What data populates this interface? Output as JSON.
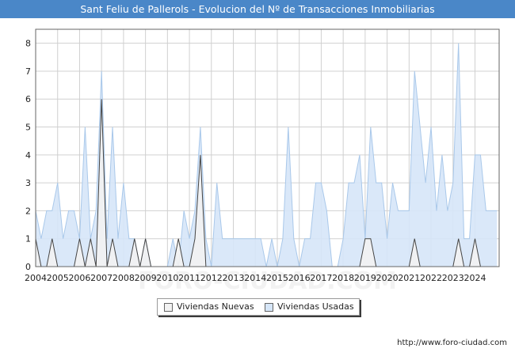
{
  "title": "Sant Feliu de Pallerols - Evolucion del Nº de Transacciones Inmobiliarias",
  "watermark": "FORO-CIUDAD.COM",
  "url": "http://www.foro-ciudad.com",
  "colors": {
    "title_bg": "#4a87c8",
    "usadas_fill": "#d6e6f8",
    "usadas_line": "#a9c8ea",
    "nuevas_fill": "#f2f2f2",
    "nuevas_line": "#444444",
    "grid": "#d0d0d0"
  },
  "chart_data": {
    "type": "area",
    "title": "Sant Feliu de Pallerols - Evolucion del Nº de Transacciones Inmobiliarias",
    "xlabel": "",
    "ylabel": "",
    "x_ticks": [
      "2004",
      "2005",
      "2006",
      "2007",
      "2008",
      "2009",
      "2010",
      "2011",
      "2012",
      "2013",
      "2014",
      "2015",
      "2016",
      "2017",
      "2018",
      "2019",
      "2020",
      "2021",
      "2022",
      "2023",
      "2024"
    ],
    "y_ticks": [
      0,
      1,
      2,
      3,
      4,
      5,
      6,
      7,
      8
    ],
    "ylim": [
      0,
      8.5
    ],
    "xlim": [
      2004,
      2025.1
    ],
    "grid": true,
    "legend_position": "bottom-center",
    "series": [
      {
        "name": "Viviendas Usadas",
        "x": [
          2004.0,
          2004.25,
          2004.5,
          2004.75,
          2005.0,
          2005.25,
          2005.5,
          2005.75,
          2006.0,
          2006.25,
          2006.5,
          2006.75,
          2007.0,
          2007.25,
          2007.5,
          2007.75,
          2008.0,
          2008.25,
          2008.5,
          2008.75,
          2009.0,
          2009.25,
          2009.5,
          2009.75,
          2010.0,
          2010.25,
          2010.5,
          2010.75,
          2011.0,
          2011.25,
          2011.5,
          2011.75,
          2012.0,
          2012.25,
          2012.5,
          2012.75,
          2013.0,
          2013.25,
          2013.5,
          2013.75,
          2014.0,
          2014.25,
          2014.5,
          2014.75,
          2015.0,
          2015.25,
          2015.5,
          2015.75,
          2016.0,
          2016.25,
          2016.5,
          2016.75,
          2017.0,
          2017.25,
          2017.5,
          2017.75,
          2018.0,
          2018.25,
          2018.5,
          2018.75,
          2019.0,
          2019.25,
          2019.5,
          2019.75,
          2020.0,
          2020.25,
          2020.5,
          2020.75,
          2021.0,
          2021.25,
          2021.5,
          2021.75,
          2022.0,
          2022.25,
          2022.5,
          2022.75,
          2023.0,
          2023.25,
          2023.5,
          2023.75,
          2024.0,
          2024.25,
          2024.5,
          2024.75,
          2025.0
        ],
        "values": [
          2,
          1,
          2,
          2,
          3,
          1,
          2,
          2,
          1,
          5,
          1,
          2,
          7,
          1,
          5,
          1,
          3,
          1,
          1,
          0,
          1,
          0,
          0,
          0,
          0,
          1,
          0,
          2,
          1,
          2,
          5,
          1,
          0,
          3,
          1,
          1,
          1,
          1,
          1,
          1,
          1,
          1,
          0,
          1,
          0,
          1,
          5,
          1,
          0,
          1,
          1,
          3,
          3,
          2,
          0,
          0,
          1,
          3,
          3,
          4,
          1,
          5,
          3,
          3,
          1,
          3,
          2,
          2,
          2,
          7,
          5,
          3,
          5,
          2,
          4,
          2,
          3,
          8,
          1,
          1,
          4,
          4,
          2,
          2,
          2
        ]
      },
      {
        "name": "Viviendas Nuevas",
        "x": [
          2004.0,
          2004.25,
          2004.5,
          2004.75,
          2005.0,
          2005.25,
          2005.5,
          2005.75,
          2006.0,
          2006.25,
          2006.5,
          2006.75,
          2007.0,
          2007.25,
          2007.5,
          2007.75,
          2008.0,
          2008.25,
          2008.5,
          2008.75,
          2009.0,
          2009.25,
          2009.5,
          2009.75,
          2010.0,
          2010.25,
          2010.5,
          2010.75,
          2011.0,
          2011.25,
          2011.5,
          2011.75,
          2012.0,
          2012.25,
          2012.5,
          2012.75,
          2013.0,
          2013.25,
          2013.5,
          2013.75,
          2014.0,
          2014.25,
          2014.5,
          2014.75,
          2015.0,
          2015.25,
          2015.5,
          2015.75,
          2016.0,
          2016.25,
          2016.5,
          2016.75,
          2017.0,
          2017.25,
          2017.5,
          2017.75,
          2018.0,
          2018.25,
          2018.5,
          2018.75,
          2019.0,
          2019.25,
          2019.5,
          2019.75,
          2020.0,
          2020.25,
          2020.5,
          2020.75,
          2021.0,
          2021.25,
          2021.5,
          2021.75,
          2022.0,
          2022.25,
          2022.5,
          2022.75,
          2023.0,
          2023.25,
          2023.5,
          2023.75,
          2024.0,
          2024.25,
          2024.5,
          2024.75,
          2025.0
        ],
        "values": [
          1,
          0,
          0,
          1,
          0,
          0,
          0,
          0,
          1,
          0,
          1,
          0,
          6,
          0,
          1,
          0,
          0,
          0,
          1,
          0,
          1,
          0,
          0,
          0,
          0,
          0,
          1,
          0,
          0,
          1,
          4,
          0,
          0,
          0,
          0,
          0,
          0,
          0,
          0,
          0,
          0,
          0,
          0,
          0,
          0,
          0,
          0,
          0,
          0,
          0,
          0,
          0,
          0,
          0,
          0,
          0,
          0,
          0,
          0,
          0,
          1,
          1,
          0,
          0,
          0,
          0,
          0,
          0,
          0,
          1,
          0,
          0,
          0,
          0,
          0,
          0,
          0,
          1,
          0,
          0,
          1,
          0,
          0,
          0,
          0
        ]
      }
    ]
  }
}
